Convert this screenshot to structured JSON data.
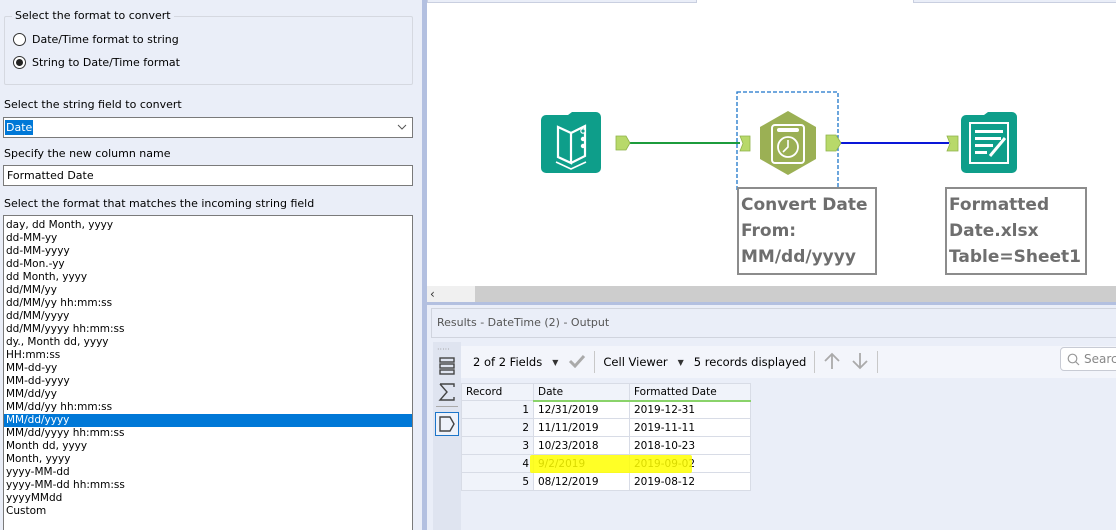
{
  "config": {
    "format_group": {
      "legend": "Select the format to convert",
      "options": [
        {
          "label": "Date/Time format to string",
          "selected": false
        },
        {
          "label": "String to Date/Time format",
          "selected": true
        }
      ]
    },
    "string_field": {
      "label": "Select the string field to convert",
      "value": "Date"
    },
    "new_column": {
      "label": "Specify the new column name",
      "value": "Formatted Date"
    },
    "format_list": {
      "label": "Select the format that matches the incoming string field",
      "selected": "MM/dd/yyyy",
      "items": [
        "day, dd Month, yyyy",
        "dd-MM-yy",
        "dd-MM-yyyy",
        "dd-Mon.-yy",
        "dd Month, yyyy",
        "dd/MM/yy",
        "dd/MM/yy hh:mm:ss",
        "dd/MM/yyyy",
        "dd/MM/yyyy hh:mm:ss",
        "dy., Month dd, yyyy",
        "HH:mm:ss",
        "MM-dd-yy",
        "MM-dd-yyyy",
        "MM/dd/yy",
        "MM/dd/yy hh:mm:ss",
        "MM/dd/yyyy",
        "MM/dd/yyyy hh:mm:ss",
        "Month dd, yyyy",
        "Month, yyyy",
        "yyyy-MM-dd",
        "yyyy-MM-dd hh:mm:ss",
        "yyyyMMdd",
        "Custom"
      ]
    }
  },
  "workflow": {
    "nodes": [
      {
        "id": "input",
        "icon": "book-icon",
        "label": ""
      },
      {
        "id": "datetime",
        "icon": "datetime-clock-icon",
        "label_lines": [
          "Convert Date",
          "From:",
          "MM/dd/yyyy"
        ]
      },
      {
        "id": "output",
        "icon": "output-writer-icon",
        "label_lines": [
          "Formatted",
          "Date.xlsx",
          "Table=Sheet1"
        ]
      }
    ],
    "colors": {
      "input_tool": "#0e9e8a",
      "datetime_tool": "#9bb054",
      "anchor": "#b8d96a",
      "connection_1": "#1c9c3c",
      "connection_2": "#0a17d8",
      "selection": "#1c75c9"
    }
  },
  "results": {
    "title": "Results - DateTime (2) - Output",
    "fields_label": "2 of 2 Fields",
    "viewer_label": "Cell Viewer",
    "records_label": "5 records displayed",
    "search_placeholder": "Search",
    "columns": [
      "Record",
      "Date",
      "Formatted Date"
    ],
    "rows": [
      [
        "1",
        "12/31/2019",
        "2019-12-31"
      ],
      [
        "2",
        "11/11/2019",
        "2019-11-11"
      ],
      [
        "3",
        "10/23/2018",
        "2018-10-23"
      ],
      [
        "4",
        "9/2/2019",
        "2019-09-02"
      ],
      [
        "5",
        "08/12/2019",
        "2019-08-12"
      ]
    ],
    "highlighted_row": 4,
    "highlight_color": "#ffff00"
  }
}
